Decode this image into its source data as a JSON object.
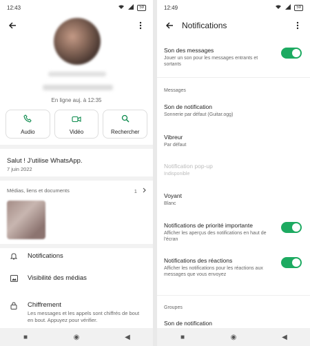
{
  "left": {
    "status_time": "12:43",
    "battery": "59",
    "last_seen": "En ligne auj. à 12:35",
    "actions": [
      {
        "label": "Audio",
        "icon": "phone-icon"
      },
      {
        "label": "Vidéo",
        "icon": "video-icon"
      },
      {
        "label": "Rechercher",
        "icon": "search-icon"
      }
    ],
    "about": "Salut ! J'utilise WhatsApp.",
    "about_date": "7 juin 2022",
    "media_title": "Médias, liens et documents",
    "media_count": "1",
    "rows": {
      "notifications": "Notifications",
      "media_visibility": "Visibilité des médias",
      "encryption_title": "Chiffrement",
      "encryption_desc": "Les messages et les appels sont chiffrés de bout en bout. Appuyez pour vérifier."
    }
  },
  "right": {
    "status_time": "12:49",
    "battery": "59",
    "title": "Notifications",
    "sound_title": "Son des messages",
    "sound_desc": "Jouer un son pour les messages entrants et sortants",
    "section_messages": "Messages",
    "notif_sound_title": "Son de notification",
    "notif_sound_value": "Sonnerie par défaut (Guitar.ogg)",
    "vibrate_title": "Vibreur",
    "vibrate_value": "Par défaut",
    "popup_title": "Notification pop-up",
    "popup_value": "Indisponible",
    "light_title": "Voyant",
    "light_value": "Blanc",
    "priority_title": "Notifications de priorité importante",
    "priority_desc": "Afficher les aperçus des notifications en haut de l'écran",
    "reactions_title": "Notifications des réactions",
    "reactions_desc": "Afficher les notifications pour les réactions aux messages que vous envoyez",
    "section_groups": "Groupes",
    "group_sound_title": "Son de notification"
  },
  "colors": {
    "accent": "#1daa61",
    "icon": "#0b8a4c"
  }
}
